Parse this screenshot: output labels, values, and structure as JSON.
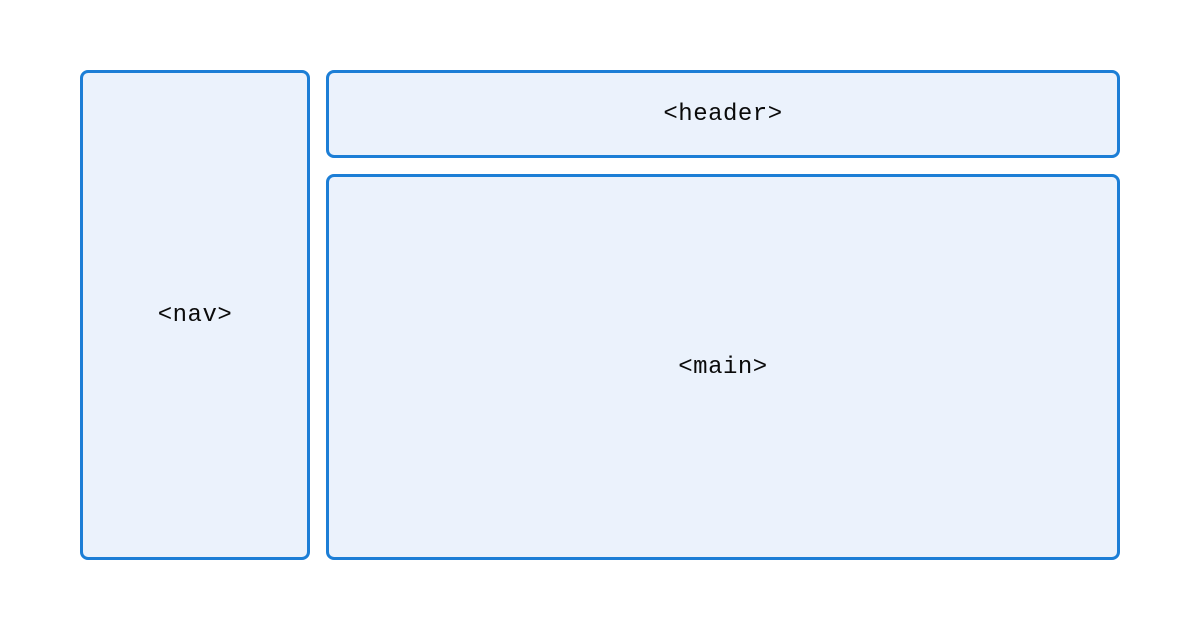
{
  "diagram": {
    "nav_label": "<nav>",
    "header_label": "<header>",
    "main_label": "<main>",
    "colors": {
      "box_fill": "#ebf2fc",
      "box_border": "#1c7ed6",
      "text": "#0a0a0a"
    }
  }
}
